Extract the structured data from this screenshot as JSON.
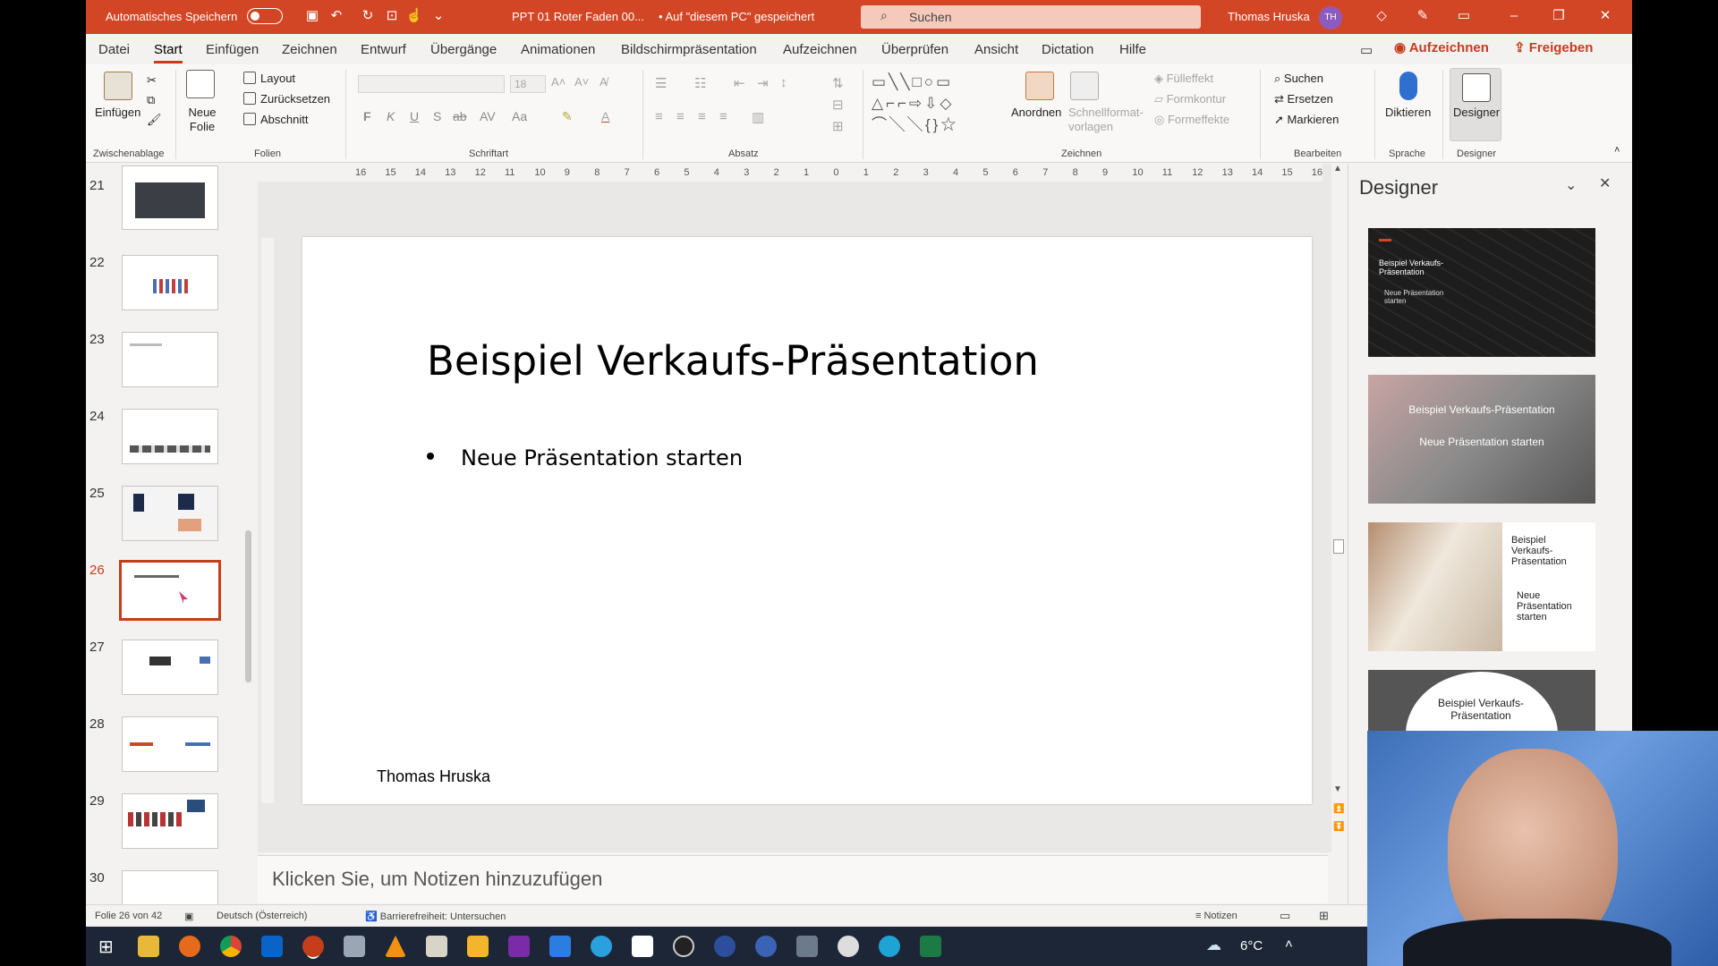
{
  "titlebar": {
    "autosave_label": "Automatisches Speichern",
    "doc_title": "PPT 01 Roter Faden 00...",
    "save_location": "• Auf \"diesem PC\" gespeichert",
    "search_placeholder": "Suchen",
    "user_name": "Thomas Hruska",
    "user_initials": "TH"
  },
  "menu": {
    "tabs": [
      "Datei",
      "Start",
      "Einfügen",
      "Zeichnen",
      "Entwurf",
      "Übergänge",
      "Animationen",
      "Bildschirmpräsentation",
      "Aufzeichnen",
      "Überprüfen",
      "Ansicht",
      "Dictation",
      "Hilfe"
    ],
    "active_tab": "Start",
    "record_button": "Aufzeichnen",
    "share_button": "Freigeben"
  },
  "ribbon": {
    "clipboard": {
      "paste": "Einfügen",
      "group": "Zwischenablage"
    },
    "slides": {
      "new_slide": "Neue Folie",
      "layout": "Layout",
      "reset": "Zurücksetzen",
      "section": "Abschnitt",
      "group": "Folien"
    },
    "font": {
      "size": "18",
      "bold": "F",
      "italic": "K",
      "underline": "U",
      "shadow": "S",
      "strike": "ab",
      "group": "Schriftart"
    },
    "paragraph": {
      "group": "Absatz"
    },
    "drawing": {
      "arrange": "Anordnen",
      "quick_styles": "Schnellformat-vorlagen",
      "fill": "Fülleffekt",
      "outline": "Formkontur",
      "effects": "Formeffekte",
      "group": "Zeichnen"
    },
    "editing": {
      "find": "Suchen",
      "replace": "Ersetzen",
      "select": "Markieren",
      "group": "Bearbeiten"
    },
    "voice": {
      "dictate": "Diktieren",
      "group": "Sprache"
    },
    "designer": {
      "label": "Designer",
      "group": "Designer"
    }
  },
  "slides_panel": {
    "numbers": [
      "21",
      "22",
      "23",
      "24",
      "25",
      "26",
      "27",
      "28",
      "29",
      "30"
    ],
    "selected": "26"
  },
  "ruler": {
    "h_ticks": [
      "16",
      "15",
      "14",
      "13",
      "12",
      "11",
      "10",
      "9",
      "8",
      "7",
      "6",
      "5",
      "4",
      "3",
      "2",
      "1",
      "0",
      "1",
      "2",
      "3",
      "4",
      "5",
      "6",
      "7",
      "8",
      "9",
      "10",
      "11",
      "12",
      "13",
      "14",
      "15",
      "16"
    ]
  },
  "slide": {
    "title": "Beispiel Verkaufs-Präsentation",
    "bullet": "Neue Präsentation starten",
    "footer": "Thomas Hruska"
  },
  "notes": {
    "placeholder": "Klicken Sie, um Notizen hinzuzufügen"
  },
  "designer_pane": {
    "title": "Designer",
    "ideas": [
      {
        "title": "Beispiel Verkaufs-Präsentation",
        "subtitle": "Neue Präsentation starten"
      },
      {
        "title": "Beispiel Verkaufs-Präsentation",
        "subtitle": "Neue Präsentation starten"
      },
      {
        "title": "Beispiel Verkaufs-Präsentation",
        "subtitle": "Neue Präsentation starten"
      },
      {
        "title": "Beispiel Verkaufs-Präsentation",
        "subtitle": ""
      }
    ]
  },
  "statusbar": {
    "slide_counter": "Folie 26 von 42",
    "language": "Deutsch (Österreich)",
    "accessibility": "Barrierefreiheit: Untersuchen",
    "notes_button": "Notizen"
  },
  "taskbar": {
    "temperature": "6°C"
  },
  "colors": {
    "accent": "#c43e1c",
    "titlebar": "#d24625",
    "taskbar": "#1c2636"
  }
}
